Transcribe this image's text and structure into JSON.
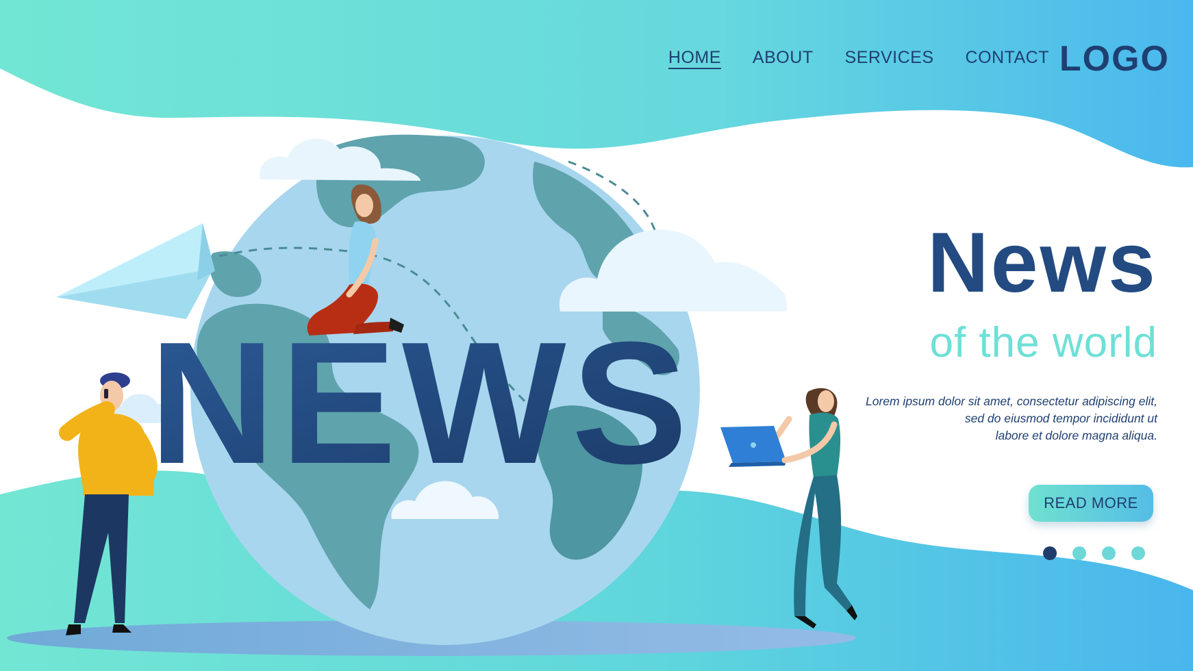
{
  "nav": {
    "links": [
      {
        "label": "HOME",
        "active": true
      },
      {
        "label": "ABOUT",
        "active": false
      },
      {
        "label": "SERVICES",
        "active": false
      },
      {
        "label": "CONTACT",
        "active": false
      }
    ],
    "logo": "LOGO"
  },
  "illustration": {
    "big_word": "NEWS",
    "icons": [
      "globe-icon",
      "paper-plane-icon",
      "cloud-icon",
      "laptop-icon",
      "phone-icon"
    ]
  },
  "hero": {
    "title": "News",
    "subtitle": "of the world",
    "body_lines": [
      "Lorem ipsum dolor sit amet, consectetur adipiscing elit,",
      "sed do eiusmod tempor incididunt ut",
      "labore et dolore magna aliqua."
    ],
    "cta_label": "READ MORE"
  },
  "pagination": {
    "count": 4,
    "active_index": 0
  },
  "colors": {
    "navy": "#1f3f71",
    "teal": "#6ee0d6",
    "blue": "#4db8ee",
    "globe_water": "#a8d6ee",
    "globe_land": "#5fa3ad"
  }
}
